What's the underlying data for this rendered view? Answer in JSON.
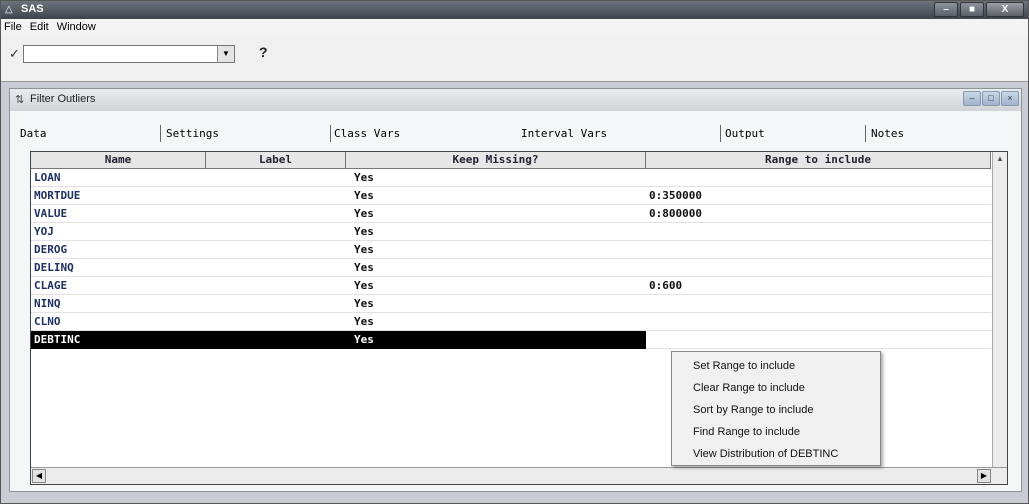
{
  "window": {
    "title": "SAS",
    "min_icon": "minimize-icon",
    "max_icon": "maximize-icon",
    "close_label": "X"
  },
  "menubar": {
    "items": [
      "File",
      "Edit",
      "Window"
    ]
  },
  "toolbar": {
    "command_value": "",
    "help_label": "?"
  },
  "child_window": {
    "title": "Filter Outliers"
  },
  "tabs": [
    "Data",
    "Settings",
    "Class Vars",
    "Interval Vars",
    "Output",
    "Notes"
  ],
  "grid": {
    "columns": [
      "Name",
      "Label",
      "Keep Missing?",
      "Range to include"
    ],
    "rows": [
      {
        "name": "LOAN",
        "label": "",
        "keep": "Yes",
        "range": ""
      },
      {
        "name": "MORTDUE",
        "label": "",
        "keep": "Yes",
        "range": "0:350000"
      },
      {
        "name": "VALUE",
        "label": "",
        "keep": "Yes",
        "range": "0:800000"
      },
      {
        "name": "YOJ",
        "label": "",
        "keep": "Yes",
        "range": ""
      },
      {
        "name": "DEROG",
        "label": "",
        "keep": "Yes",
        "range": ""
      },
      {
        "name": "DELINQ",
        "label": "",
        "keep": "Yes",
        "range": ""
      },
      {
        "name": "CLAGE",
        "label": "",
        "keep": "Yes",
        "range": "0:600"
      },
      {
        "name": "NINQ",
        "label": "",
        "keep": "Yes",
        "range": ""
      },
      {
        "name": "CLNO",
        "label": "",
        "keep": "Yes",
        "range": ""
      },
      {
        "name": "DEBTINC",
        "label": "",
        "keep": "Yes",
        "range": "",
        "selected": true
      }
    ]
  },
  "context_menu": {
    "items": [
      "Set Range to include",
      "Clear Range to include",
      "Sort by Range to include",
      "Find Range to include",
      "View Distribution of DEBTINC"
    ]
  }
}
